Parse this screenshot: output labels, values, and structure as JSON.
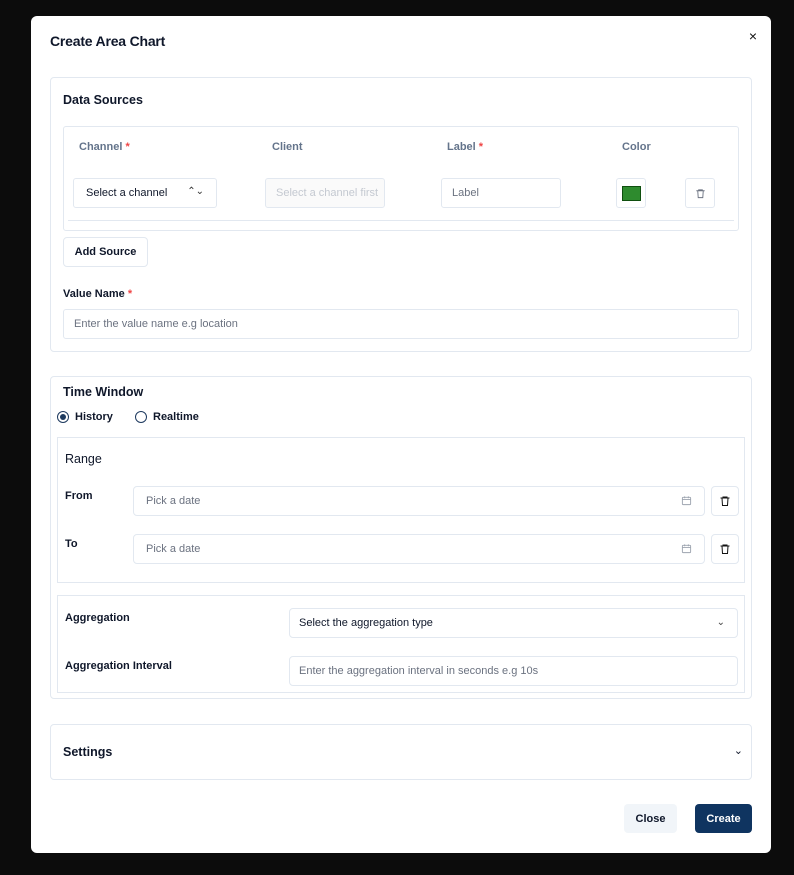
{
  "dialog": {
    "title": "Create Area Chart",
    "close_icon": "×"
  },
  "data_sources": {
    "title": "Data Sources",
    "columns": {
      "channel": "Channel",
      "client": "Client",
      "label": "Label",
      "color": "Color",
      "required_mark": "*"
    },
    "row": {
      "channel_value": "Select a channel",
      "client_placeholder": "Select a channel first",
      "label_placeholder": "Label",
      "color": "#2e8b2e"
    },
    "add_source_label": "Add Source",
    "value_name_label": "Value Name",
    "value_name_placeholder": "Enter the value name e.g location"
  },
  "time_window": {
    "title": "Time Window",
    "modes": [
      {
        "label": "History",
        "selected": true
      },
      {
        "label": "Realtime",
        "selected": false
      }
    ],
    "range_title": "Range",
    "from_label": "From",
    "from_placeholder": "Pick a date",
    "to_label": "To",
    "to_placeholder": "Pick a date",
    "aggregation_label": "Aggregation",
    "aggregation_value": "Select the aggregation type",
    "interval_label": "Aggregation Interval",
    "interval_placeholder": "Enter the aggregation interval in seconds e.g 10s"
  },
  "settings": {
    "title": "Settings"
  },
  "footer": {
    "close_label": "Close",
    "create_label": "Create"
  }
}
